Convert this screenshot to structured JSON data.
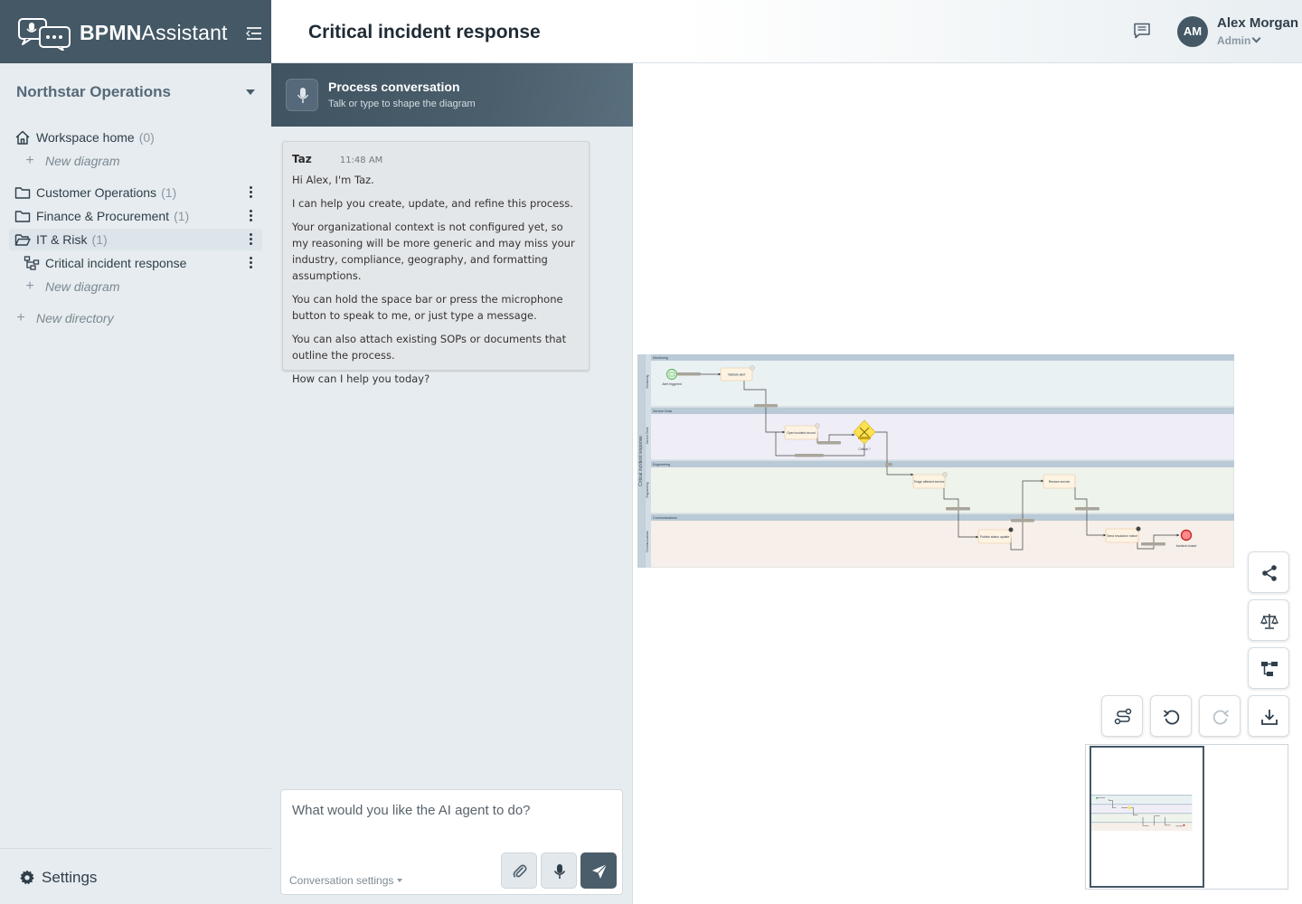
{
  "app": {
    "brand_bold": "BPMN",
    "brand_rest": "Assistant",
    "workspace": "Northstar Operations"
  },
  "sidebar": {
    "items": [
      {
        "label": "Workspace home",
        "count": "(0)",
        "icon": "home-icon"
      },
      {
        "label": "New diagram",
        "icon": "plus-icon"
      },
      {
        "label": "Customer Operations",
        "count": "(1)",
        "icon": "folder-icon"
      },
      {
        "label": "Finance & Procurement",
        "count": "(1)",
        "icon": "folder-icon"
      },
      {
        "label": "IT & Risk",
        "count": "(1)",
        "icon": "folder-open-icon"
      },
      {
        "label": "Critical incident response",
        "icon": "diagram-icon"
      },
      {
        "label": "New diagram",
        "icon": "plus-icon"
      },
      {
        "label": "New directory",
        "icon": "plus-icon"
      }
    ],
    "settings_label": "Settings"
  },
  "header": {
    "title": "Critical incident response",
    "user_initials": "AM",
    "user_name": "Alex Morgan",
    "user_role": "Admin"
  },
  "chat": {
    "title": "Process conversation",
    "subtitle": "Talk or type to shape the diagram",
    "message": {
      "author": "Taz",
      "time": "11:48 AM",
      "paragraphs": [
        "Hi Alex, I'm Taz.",
        "I can help you create, update, and refine this process.",
        "Your organizational context is not configured yet, so my reasoning will be more generic and may miss your industry, compliance, geography, and formatting assumptions.",
        "You can hold the space bar or press the microphone button to speak to me, or just type a message.",
        "You can also attach existing SOPs or documents that outline the process.",
        "How can I help you today?"
      ]
    },
    "input_placeholder": "What would you like the AI agent to do?",
    "conversation_settings": "Conversation settings"
  },
  "diagram": {
    "pool_name": "Critical incident response",
    "lanes": [
      "Monitoring",
      "Service Desk",
      "Engineering",
      "Communications"
    ],
    "nodes": {
      "start": "Alert triggered",
      "validate": "Validate alert",
      "open_record": "Open incident record",
      "gateway": "Critical ?",
      "triage": "Triage affected service",
      "restore": "Restore service",
      "publish": "Publish status update",
      "send_resolution": "Send resolution notice",
      "end": "Incident closed"
    }
  },
  "colors": {
    "brand": "#445866",
    "lane_monitoring": "#eaf1f3",
    "lane_service_desk": "#efedf6",
    "lane_engineering": "#eef3eb",
    "lane_communications": "#f7efe9",
    "task_fill": "#fdf3e3",
    "gateway_fill": "#ffe24d"
  }
}
